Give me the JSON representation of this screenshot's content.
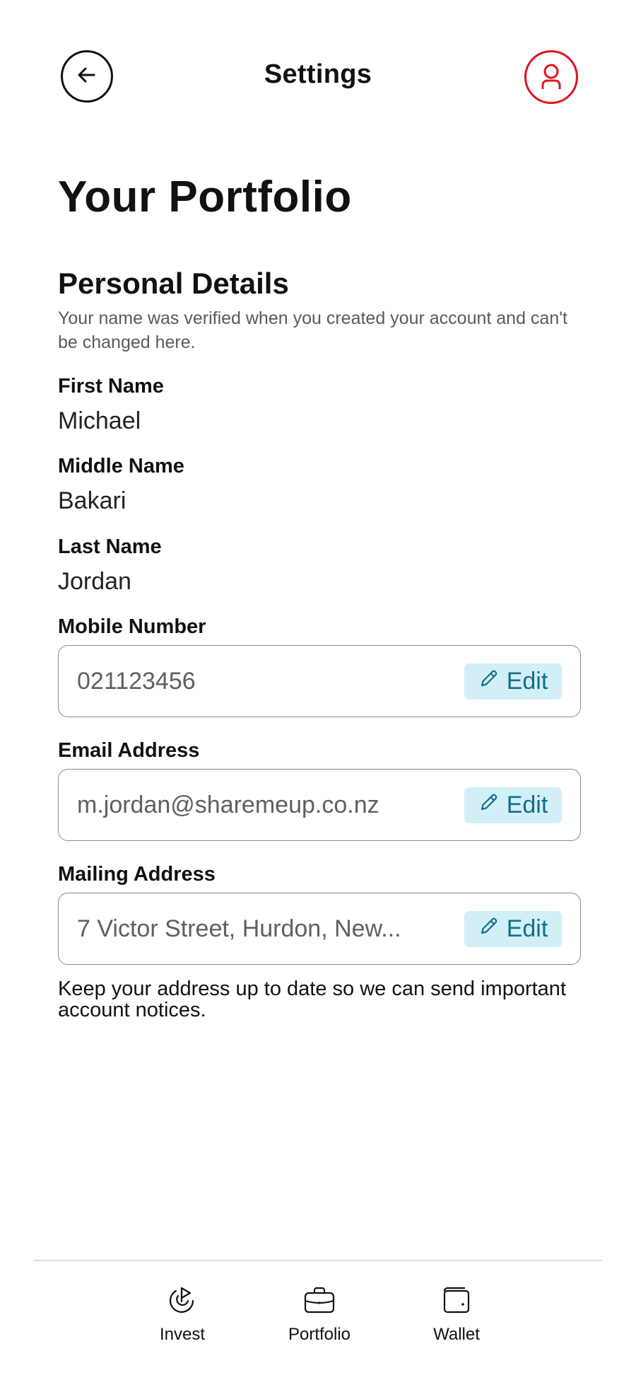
{
  "header": {
    "title": "Settings",
    "back_icon": "arrow-left-icon",
    "profile_icon": "user-icon",
    "profile_color": "#e0141e"
  },
  "page": {
    "title": "Your Portfolio"
  },
  "personal_details": {
    "title": "Personal Details",
    "description": "Your name was verified when you created your account and can't be changed here.",
    "first_name_label": "First Name",
    "first_name": "Michael",
    "middle_name_label": "Middle Name",
    "middle_name": "Bakari",
    "last_name_label": "Last Name",
    "last_name": "Jordan",
    "mobile_label": "Mobile Number",
    "mobile_value": "021123456",
    "email_label": "Email Address",
    "email_value": "m.jordan@sharemeup.co.nz",
    "mailing_label": "Mailing Address",
    "mailing_value": "7 Victor Street, Hurdon, New...",
    "edit_label": "Edit",
    "help_text": "Keep your address up to date so we can send important account notices."
  },
  "colors": {
    "accent_red": "#e0141e",
    "edit_bg": "#d2eff7",
    "edit_text": "#136e8a"
  },
  "bottom_nav": {
    "items": [
      {
        "label": "Invest",
        "icon": "invest-icon"
      },
      {
        "label": "Portfolio",
        "icon": "briefcase-icon"
      },
      {
        "label": "Wallet",
        "icon": "wallet-icon"
      }
    ]
  }
}
